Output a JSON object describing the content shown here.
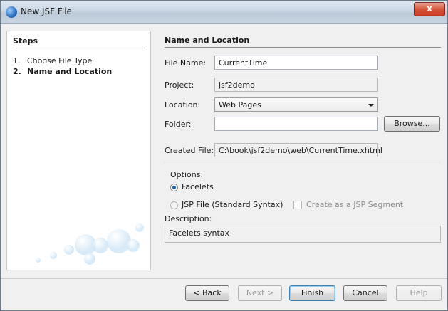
{
  "window": {
    "title": "New JSF File",
    "close_glyph": "x"
  },
  "steps": {
    "title": "Steps",
    "items": [
      {
        "num": "1.",
        "label": "Choose File Type"
      },
      {
        "num": "2.",
        "label": "Name and Location"
      }
    ]
  },
  "panel": {
    "title": "Name and Location",
    "file_name_label": "File Name:",
    "file_name_value": "CurrentTime",
    "project_label": "Project:",
    "project_value": "jsf2demo",
    "location_label": "Location:",
    "location_value": "Web Pages",
    "folder_label": "Folder:",
    "folder_value": "",
    "browse_label": "Browse...",
    "created_file_label": "Created File:",
    "created_file_value": "C:\\book\\jsf2demo\\web\\CurrentTime.xhtml",
    "options_label": "Options:",
    "facelets_label": "Facelets",
    "jsp_label": "JSP File (Standard Syntax)",
    "jsp_segment_label": "Create as a JSP Segment",
    "description_label": "Description:",
    "description_value": "Facelets syntax"
  },
  "buttons": {
    "back": "< Back",
    "next": "Next >",
    "finish": "Finish",
    "cancel": "Cancel",
    "help": "Help"
  }
}
